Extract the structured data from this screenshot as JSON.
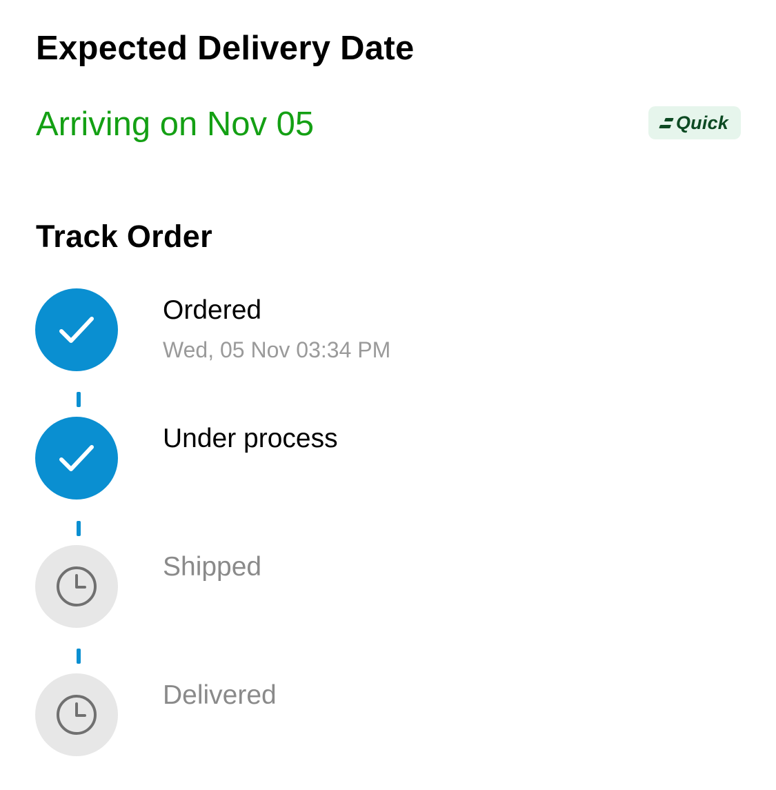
{
  "delivery": {
    "title": "Expected Delivery Date",
    "arrival_text": "Arriving on Nov 05",
    "arrival_color": "#14a014",
    "badge_label": "Quick",
    "badge_color": "#0d4a23",
    "badge_background": "#e6f5ec"
  },
  "tracking": {
    "title": "Track Order",
    "accent_color": "#0a8fd1",
    "steps": [
      {
        "label": "Ordered",
        "time": "Wed, 05 Nov 03:34 PM",
        "status": "done",
        "icon": "checkmark-icon"
      },
      {
        "label": "Under process",
        "time": "",
        "status": "done",
        "icon": "checkmark-icon"
      },
      {
        "label": "Shipped",
        "time": "",
        "status": "pending",
        "icon": "clock-icon"
      },
      {
        "label": "Delivered",
        "time": "",
        "status": "pending",
        "icon": "clock-icon"
      }
    ]
  }
}
